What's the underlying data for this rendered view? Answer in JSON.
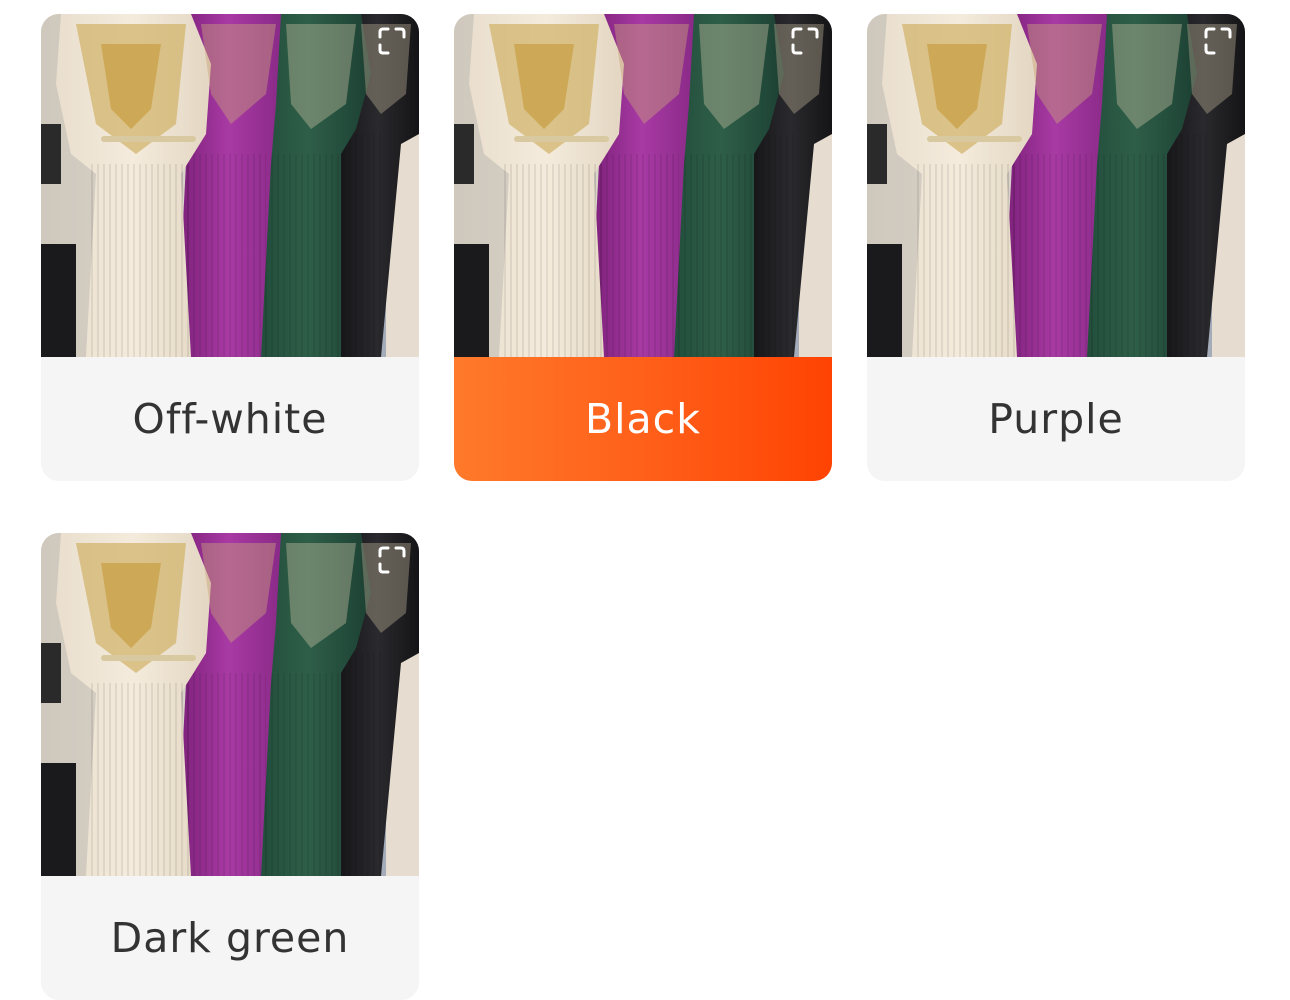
{
  "variants": [
    {
      "label": "Off-white",
      "selected": false,
      "image": "dresses-photo"
    },
    {
      "label": "Black",
      "selected": true,
      "image": "dresses-photo"
    },
    {
      "label": "Purple",
      "selected": false,
      "image": "dresses-photo"
    },
    {
      "label": "Dark green",
      "selected": false,
      "image": "dresses-photo"
    }
  ],
  "colors": {
    "accent_start": "#ff7a2a",
    "accent_end": "#ff4302",
    "card_bg": "#f5f5f5",
    "label_text": "#333333"
  },
  "icons": {
    "expand": "expand-icon"
  }
}
